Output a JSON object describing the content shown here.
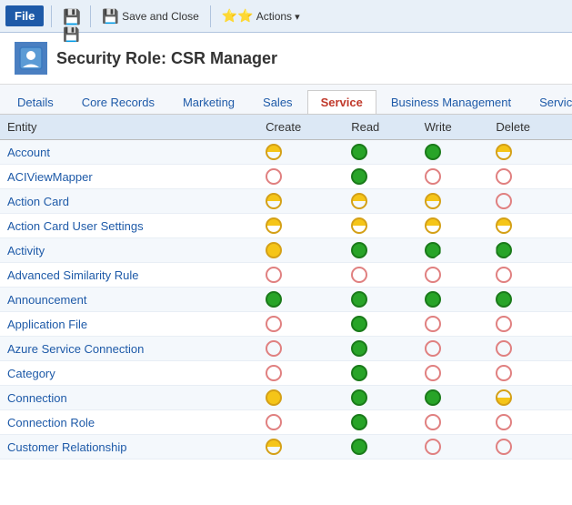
{
  "toolbar": {
    "file_label": "File",
    "save_label": "Save",
    "save_close_label": "Save and Close",
    "actions_label": "Actions"
  },
  "header": {
    "title": "Security Role: CSR Manager"
  },
  "tabs": [
    {
      "label": "Details",
      "active": false
    },
    {
      "label": "Core Records",
      "active": false
    },
    {
      "label": "Marketing",
      "active": false
    },
    {
      "label": "Sales",
      "active": false
    },
    {
      "label": "Service",
      "active": true
    },
    {
      "label": "Business Management",
      "active": false
    },
    {
      "label": "Service",
      "active": false
    }
  ],
  "columns": [
    "Entity",
    "Create",
    "Read",
    "Write",
    "Delete"
  ],
  "rows": [
    {
      "entity": "Account",
      "create": "half-yellow",
      "read": "full-green",
      "write": "full-green",
      "delete": "half-yellow"
    },
    {
      "entity": "ACIViewMapper",
      "create": "empty",
      "read": "full-green",
      "write": "empty",
      "delete": "empty"
    },
    {
      "entity": "Action Card",
      "create": "half-yellow",
      "read": "half-yellow",
      "write": "half-yellow",
      "delete": "empty"
    },
    {
      "entity": "Action Card User Settings",
      "create": "half-yellow",
      "read": "half-yellow",
      "write": "half-yellow",
      "delete": "half-yellow"
    },
    {
      "entity": "Activity",
      "create": "full-yellow",
      "read": "full-green",
      "write": "green-cut",
      "delete": "green-cut"
    },
    {
      "entity": "Advanced Similarity Rule",
      "create": "empty",
      "read": "empty",
      "write": "empty",
      "delete": "empty"
    },
    {
      "entity": "Announcement",
      "create": "full-green",
      "read": "full-green",
      "write": "full-green",
      "delete": "full-green"
    },
    {
      "entity": "Application File",
      "create": "empty",
      "read": "full-green",
      "write": "empty",
      "delete": "empty"
    },
    {
      "entity": "Azure Service Connection",
      "create": "empty",
      "read": "full-green",
      "write": "empty",
      "delete": "empty"
    },
    {
      "entity": "Category",
      "create": "empty",
      "read": "full-green",
      "write": "empty",
      "delete": "empty"
    },
    {
      "entity": "Connection",
      "create": "full-yellow",
      "read": "full-green",
      "write": "full-green",
      "delete": "half-yellow-bottom"
    },
    {
      "entity": "Connection Role",
      "create": "empty",
      "read": "full-green",
      "write": "empty",
      "delete": "empty"
    },
    {
      "entity": "Customer Relationship",
      "create": "half-yellow",
      "read": "full-green",
      "write": "empty",
      "delete": "empty"
    }
  ]
}
